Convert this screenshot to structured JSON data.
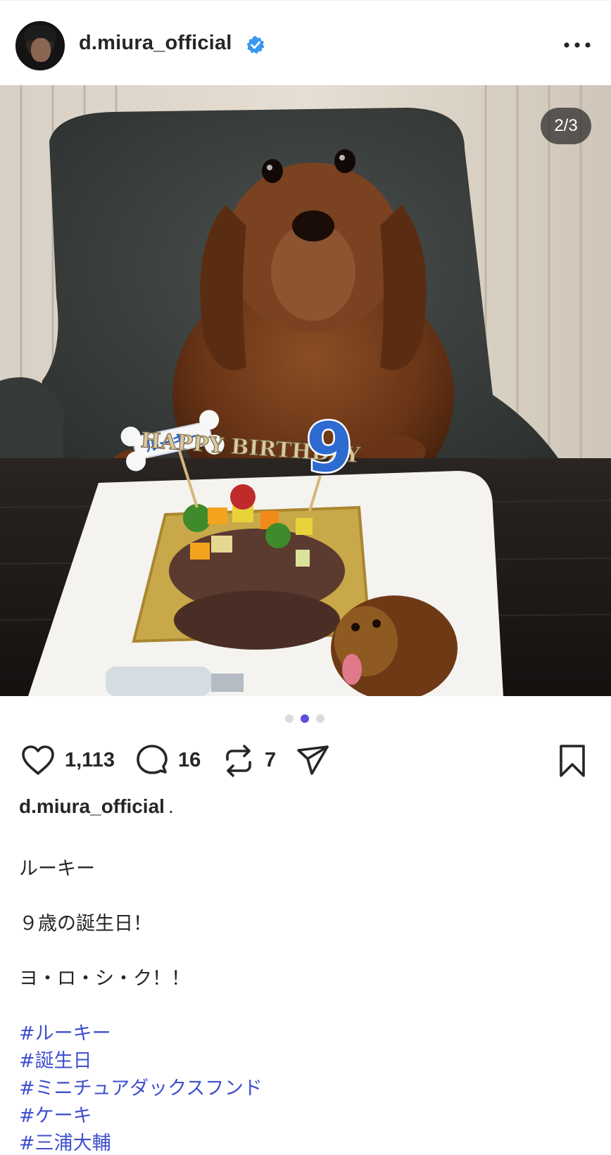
{
  "post": {
    "username": "d.miura_official",
    "verified": true,
    "menu_icon": "more-horizontal-icon",
    "media": {
      "counter": "2/3",
      "current_index": 2,
      "total": 3,
      "cake_topper_name": "ルーキー",
      "cake_topper_text": "HAPPY BIRTHDAY",
      "candle_number": "9"
    },
    "actions": {
      "likes": "1,113",
      "comments": "16",
      "reposts": "7"
    },
    "caption": {
      "username": "d.miura_official",
      "suffix": ".",
      "lines": [
        "ルーキー",
        "９歳の誕生日！",
        "ヨ・ロ・シ・ク！！"
      ],
      "hashtags": [
        "#ルーキー",
        "#誕生日",
        "#ミニチュアダックスフンド",
        "#ケーキ",
        "#三浦大輔"
      ]
    }
  },
  "colors": {
    "text": "#262626",
    "hashtag": "#3f4fcf",
    "verified_badge": "#3897f0",
    "active_dot": "#5b51d8",
    "inactive_dot": "#dbdbdb"
  }
}
